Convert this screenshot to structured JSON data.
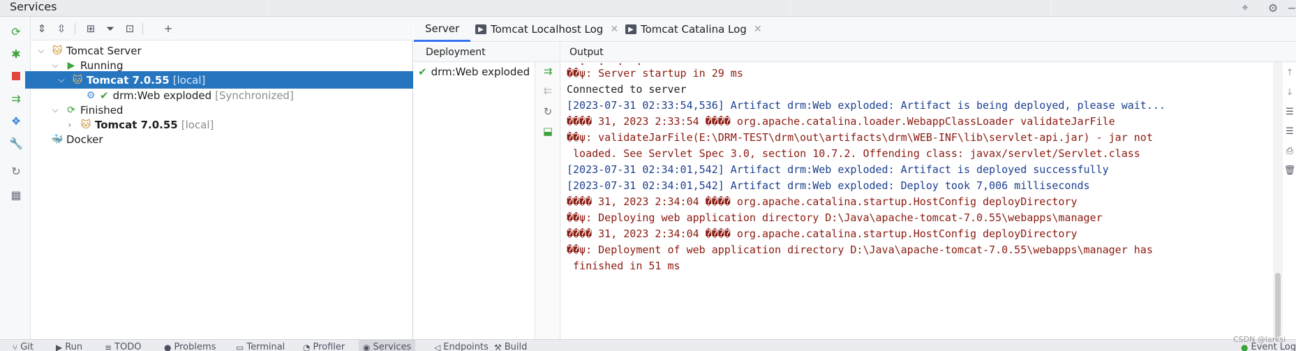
{
  "window": {
    "title": "Services"
  },
  "tree": {
    "rows": [
      {
        "label": "Tomcat Server",
        "suffix": ""
      },
      {
        "label": "Running",
        "suffix": ""
      },
      {
        "label": "Tomcat 7.0.55",
        "suffix": "[local]"
      },
      {
        "label": "drm:Web exploded",
        "suffix": "[Synchronized]"
      },
      {
        "label": "Finished",
        "suffix": ""
      },
      {
        "label": "Tomcat 7.0.55",
        "suffix": "[local]"
      },
      {
        "label": "Docker",
        "suffix": ""
      }
    ]
  },
  "tabs": [
    {
      "label": "Server"
    },
    {
      "label": "Tomcat Localhost Log"
    },
    {
      "label": "Tomcat Catalina Log"
    }
  ],
  "deployment": {
    "header": "Deployment",
    "items": [
      {
        "label": "drm:Web exploded"
      }
    ]
  },
  "output": {
    "header": "Output",
    "lines": [
      {
        "text": "��ψ: Server startup in 29 ms",
        "color": "red"
      },
      {
        "text": "Connected to server",
        "color": "black"
      },
      {
        "text": "[2023-07-31 02:33:54,536] Artifact drm:Web exploded: Artifact is being deployed, please wait...",
        "color": "blue"
      },
      {
        "text": "���� 31, 2023 2:33:54 ���� org.apache.catalina.loader.WebappClassLoader validateJarFile",
        "color": "red"
      },
      {
        "text": "��ψ: validateJarFile(E:\\DRM-TEST\\drm\\out\\artifacts\\drm\\WEB-INF\\lib\\servlet-api.jar) - jar not",
        "color": "red"
      },
      {
        "text": " loaded. See Servlet Spec 3.0, section 10.7.2. Offending class: javax/servlet/Servlet.class",
        "color": "red"
      },
      {
        "text": "[2023-07-31 02:34:01,542] Artifact drm:Web exploded: Artifact is deployed successfully",
        "color": "blue"
      },
      {
        "text": "[2023-07-31 02:34:01,542] Artifact drm:Web exploded: Deploy took 7,006 milliseconds",
        "color": "blue"
      },
      {
        "text": "���� 31, 2023 2:34:04 ���� org.apache.catalina.startup.HostConfig deployDirectory",
        "color": "red"
      },
      {
        "text": "��ψ: Deploying web application directory D:\\Java\\apache-tomcat-7.0.55\\webapps\\manager",
        "color": "red"
      },
      {
        "text": "���� 31, 2023 2:34:04 ���� org.apache.catalina.startup.HostConfig deployDirectory",
        "color": "red"
      },
      {
        "text": "��ψ: Deployment of web application directory D:\\Java\\apache-tomcat-7.0.55\\webapps\\manager has",
        "color": "red"
      },
      {
        "text": " finished in 51 ms",
        "color": "red"
      }
    ]
  },
  "statusbar": {
    "items": [
      {
        "label": "Git"
      },
      {
        "label": "Run"
      },
      {
        "label": "TODO"
      },
      {
        "label": "Problems"
      },
      {
        "label": "Terminal"
      },
      {
        "label": "Profiler"
      },
      {
        "label": "Services"
      },
      {
        "label": "Endpoints"
      },
      {
        "label": "Build"
      },
      {
        "label": "Event Log"
      }
    ]
  },
  "watermark": "CSDN @larksi",
  "colors": {
    "selection": "#2675bf",
    "error_text": "#8b1a10",
    "info_text": "#1b3f8f",
    "run_green": "#3ca33c",
    "accent": "#3574f0"
  }
}
